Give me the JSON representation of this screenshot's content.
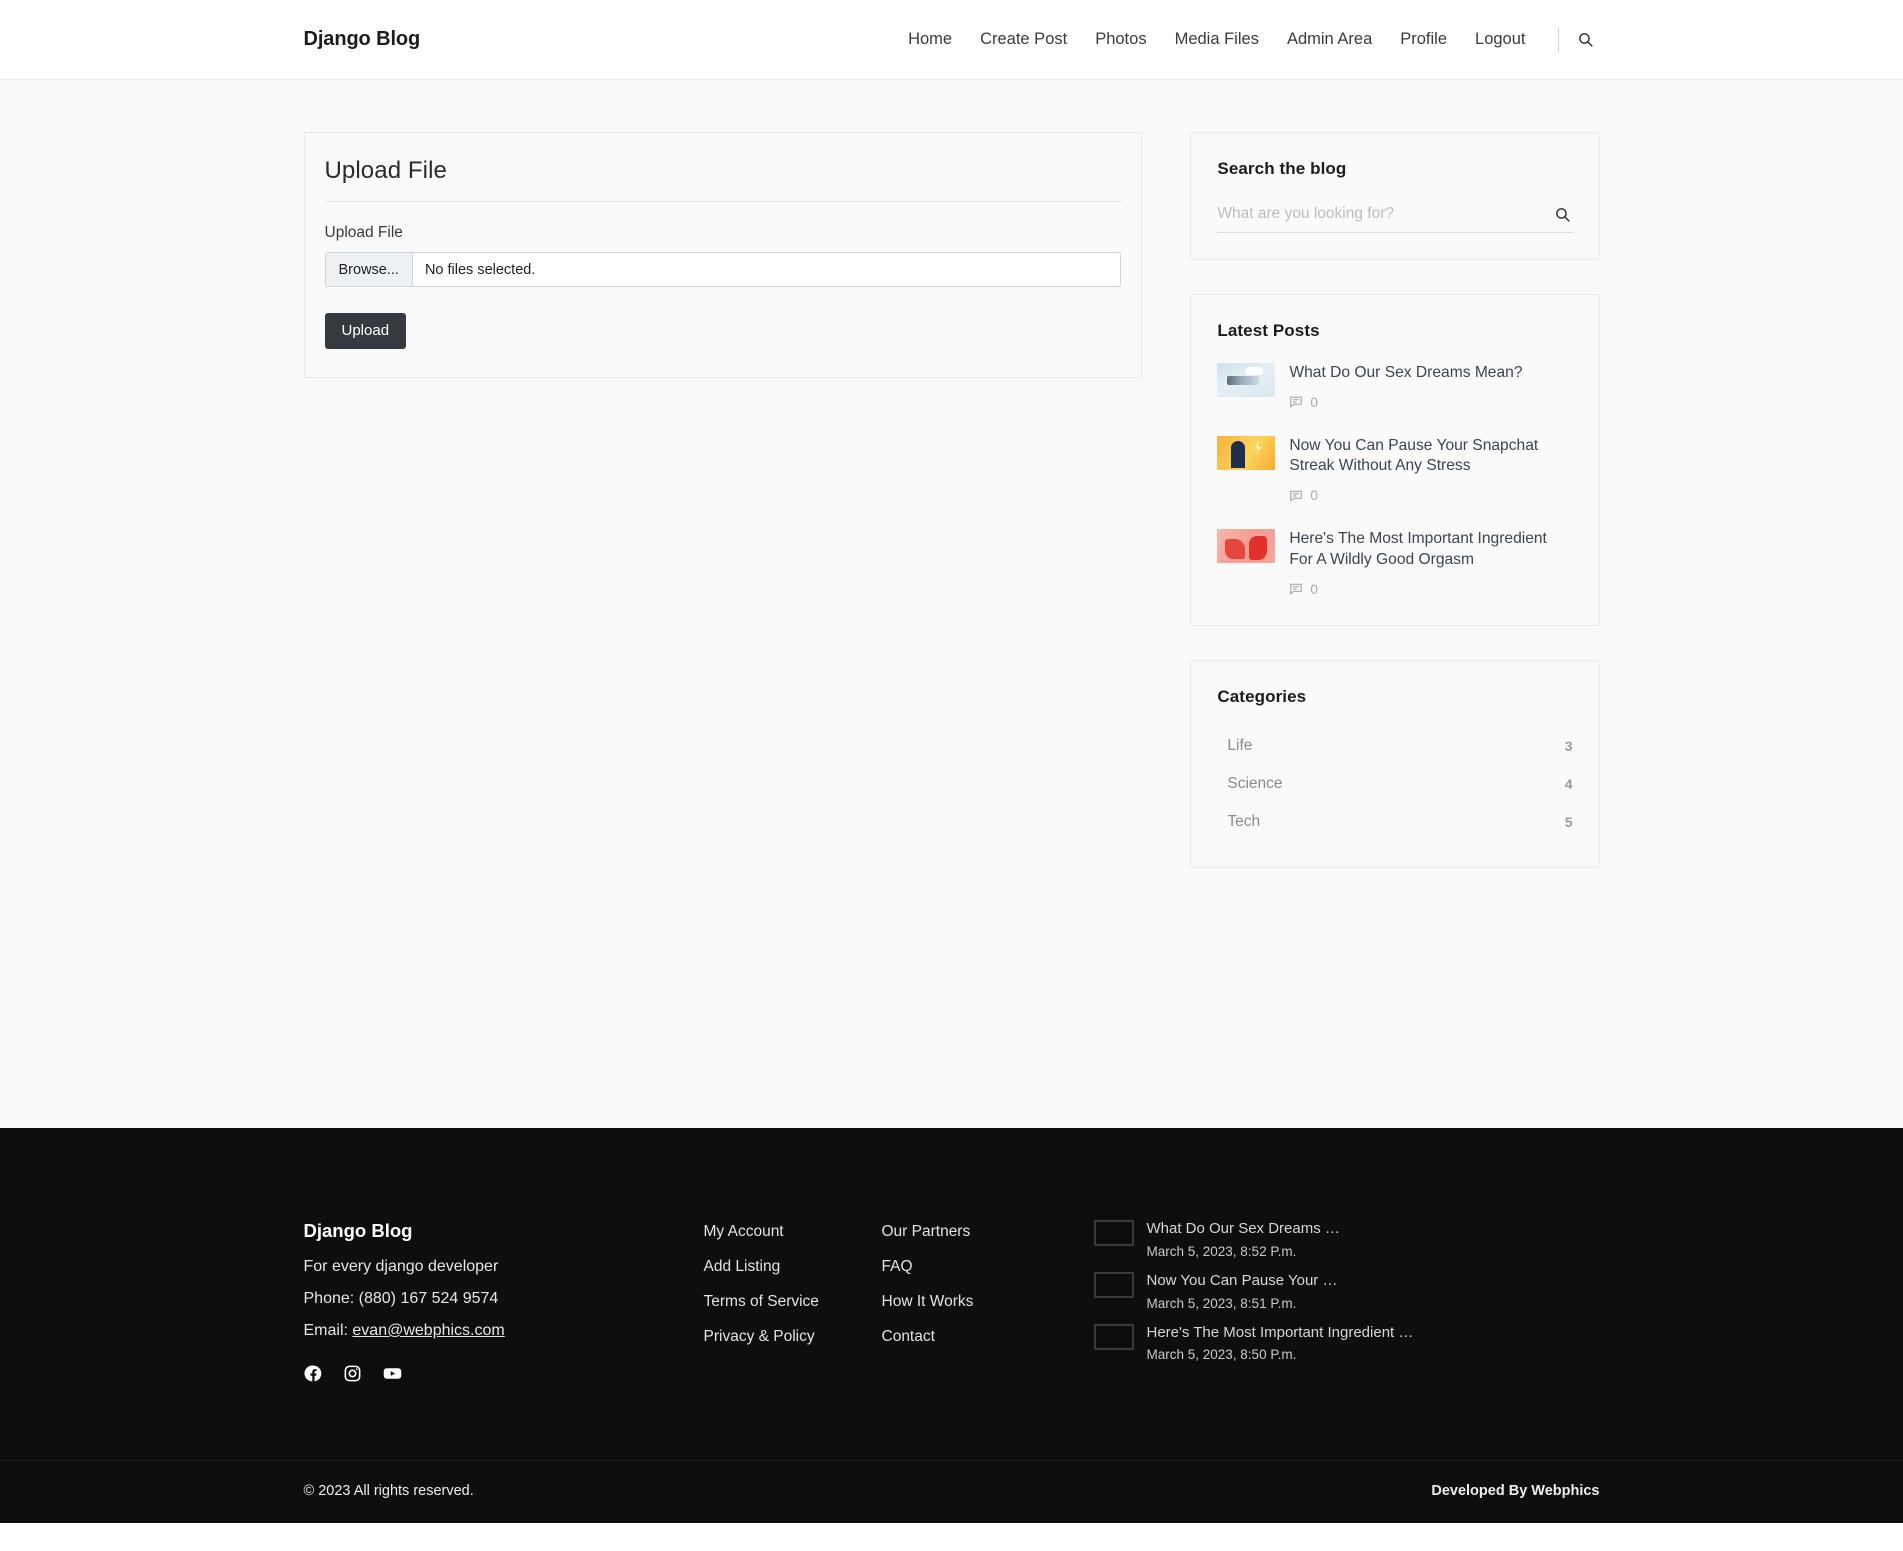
{
  "header": {
    "brand": "Django Blog",
    "nav": [
      {
        "label": "Home"
      },
      {
        "label": "Create Post"
      },
      {
        "label": "Photos"
      },
      {
        "label": "Media Files"
      },
      {
        "label": "Admin Area"
      },
      {
        "label": "Profile"
      },
      {
        "label": "Logout"
      }
    ],
    "search_icon": "search-icon"
  },
  "main": {
    "card_title": "Upload File",
    "field_label": "Upload File",
    "browse_button": "Browse...",
    "file_status": "No files selected.",
    "submit_button": "Upload"
  },
  "sidebar": {
    "search": {
      "title": "Search the blog",
      "placeholder": "What are you looking for?",
      "value": "",
      "submit_icon": "search-icon"
    },
    "latest": {
      "title": "Latest Posts",
      "posts": [
        {
          "title": "What Do Our Sex Dreams Mean?",
          "comments": "0",
          "thumb": "t-dreams"
        },
        {
          "title": "Now You Can Pause Your Snapchat Streak Without Any Stress",
          "comments": "0",
          "thumb": "t-snap"
        },
        {
          "title": "Here's The Most Important Ingredient For A Wildly Good Orgasm",
          "comments": "0",
          "thumb": "t-orgasm"
        }
      ]
    },
    "categories": {
      "title": "Categories",
      "items": [
        {
          "name": "Life",
          "count": "3"
        },
        {
          "name": "Science",
          "count": "4"
        },
        {
          "name": "Tech",
          "count": "5"
        }
      ]
    }
  },
  "footer": {
    "brand": "Django Blog",
    "tagline": "For every django developer",
    "phone": "Phone: (880) 167 524 9574",
    "email_label": "Email:",
    "email": "evan@webphics.com",
    "socials": [
      {
        "name": "facebook-icon"
      },
      {
        "name": "instagram-icon"
      },
      {
        "name": "youtube-icon"
      }
    ],
    "links_col1": [
      {
        "label": "My Account"
      },
      {
        "label": "Add Listing"
      },
      {
        "label": "Terms of Service"
      },
      {
        "label": "Privacy & Policy"
      }
    ],
    "links_col2": [
      {
        "label": "Our Partners"
      },
      {
        "label": "FAQ"
      },
      {
        "label": "How It Works"
      },
      {
        "label": "Contact"
      }
    ],
    "recent": [
      {
        "title": "What Do Our Sex Dreams …",
        "date": "March 5, 2023, 8:52 P.m.",
        "thumb": "t-dreams"
      },
      {
        "title": "Now You Can Pause Your …",
        "date": "March 5, 2023, 8:51 P.m.",
        "thumb": "t-snap"
      },
      {
        "title": "Here's The Most Important Ingredient …",
        "date": "March 5, 2023, 8:50 P.m.",
        "thumb": "t-orgasm"
      }
    ],
    "copyright": "© 2023 All rights reserved.",
    "developed": "Developed By Webphics"
  }
}
